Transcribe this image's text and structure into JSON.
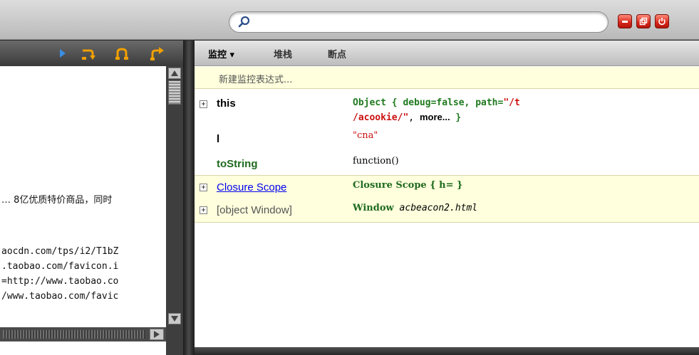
{
  "search": {
    "value": "",
    "placeholder": ""
  },
  "window_buttons": [
    {
      "name": "minimize",
      "icon": "minimize-icon"
    },
    {
      "name": "restore",
      "icon": "restore-icon"
    },
    {
      "name": "close",
      "icon": "power-icon"
    }
  ],
  "debug_toolbar": {
    "buttons": [
      {
        "name": "continue",
        "icon": "play-icon"
      },
      {
        "name": "step-over",
        "icon": "step-over-icon"
      },
      {
        "name": "step-into",
        "icon": "step-into-icon"
      },
      {
        "name": "step-out",
        "icon": "step-out-icon"
      }
    ]
  },
  "source_lines": {
    "line1": "… 8亿优质特价商品，同时",
    "line2": "aocdn.com/tps/i2/T1bZ",
    "line3": ".taobao.com/favicon.i",
    "line4": "=http://www.taobao.co",
    "line5": "/www.taobao.com/favic"
  },
  "tabs": {
    "watch": "监控 ▾",
    "stack": "堆栈",
    "breakpoints": "断点"
  },
  "watch_panel": {
    "new_expression": "新建监控表达式...",
    "rows": {
      "this_name": "this",
      "this_value_prefix": "Object { debug=",
      "this_value_debug": "false",
      "this_value_path_key": ", path=",
      "this_value_path_line1": "\"/t",
      "this_value_path_line2": "/acookie/\"",
      "this_value_more": "more...",
      "this_value_close": " }",
      "l_name": "l",
      "l_value": "\"cna\"",
      "tostring_name": "toString",
      "tostring_value": "function()",
      "closure_name": "Closure Scope",
      "closure_value": "Closure Scope { h= }",
      "window_name": "[object Window]",
      "window_value_prefix": "Window",
      "window_value_file": "acbeacon2.html"
    }
  },
  "colors": {
    "accent_red": "#d8261a",
    "value_green": "#1f7a1f",
    "string_red": "#cc1111",
    "highlight_yellow": "#ffffdd",
    "link_blue": "#0000ee"
  }
}
